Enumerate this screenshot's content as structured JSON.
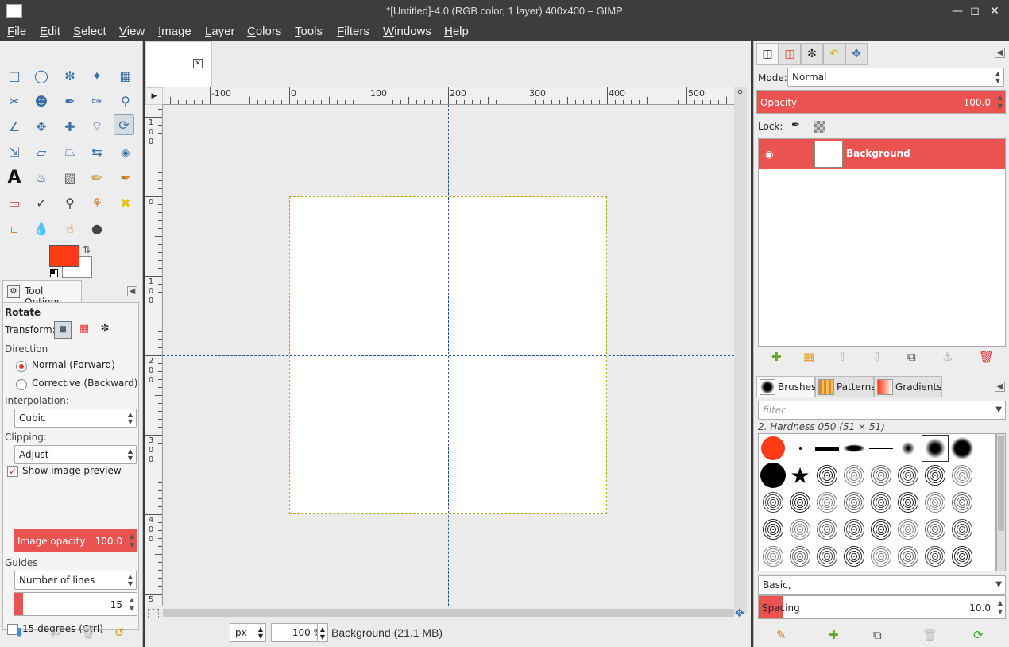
{
  "window": {
    "title": "*[Untitled]-4.0 (RGB color, 1 layer) 400x400 – GIMP"
  },
  "menu": [
    "File",
    "Edit",
    "Select",
    "View",
    "Image",
    "Layer",
    "Colors",
    "Tools",
    "Filters",
    "Windows",
    "Help"
  ],
  "colors": {
    "foreground": "#ff3a17",
    "background": "#ffffff",
    "accent": "#ea5350",
    "guide": "#1f4da0"
  },
  "tool_options": {
    "tab_label": "Tool Options",
    "tool_name": "Rotate",
    "transform_label": "Transform:",
    "direction_label": "Direction",
    "direction_options": [
      "Normal (Forward)",
      "Corrective (Backward)"
    ],
    "direction_selected": "Normal (Forward)",
    "interpolation_label": "Interpolation:",
    "interpolation_value": "Cubic",
    "clipping_label": "Clipping:",
    "clipping_value": "Adjust",
    "show_preview_label": "Show image preview",
    "show_preview_checked": true,
    "image_opacity_label": "Image opacity",
    "image_opacity_value": "100.0",
    "guides_label": "Guides",
    "guides_value": "Number of lines",
    "guides_count": "15",
    "guides_count_fraction": 0.07,
    "constrain_label": "15 degrees  (Ctrl)",
    "constrain_checked": false
  },
  "canvas": {
    "hruler_labels": [
      "-100",
      "0",
      "100",
      "200",
      "300",
      "400",
      "500"
    ],
    "vruler_labels": [
      "100",
      "0",
      "100",
      "200",
      "300",
      "400",
      "5"
    ],
    "unit": "px",
    "zoom": "100 %",
    "status": "Background (21.1 MB)"
  },
  "layers": {
    "mode_label": "Mode:",
    "mode_value": "Normal",
    "opacity_label": "Opacity",
    "opacity_value": "100.0",
    "lock_label": "Lock:",
    "items": [
      {
        "name": "Background",
        "visible": true
      }
    ]
  },
  "brushes": {
    "tabs": [
      "Brushes",
      "Patterns",
      "Gradients"
    ],
    "filter_placeholder": "filter",
    "selected_brush": "2. Hardness 050 (51 × 51)",
    "tag_value": "Basic,",
    "spacing_label": "Spacing",
    "spacing_value": "10.0",
    "spacing_fraction": 0.1
  }
}
